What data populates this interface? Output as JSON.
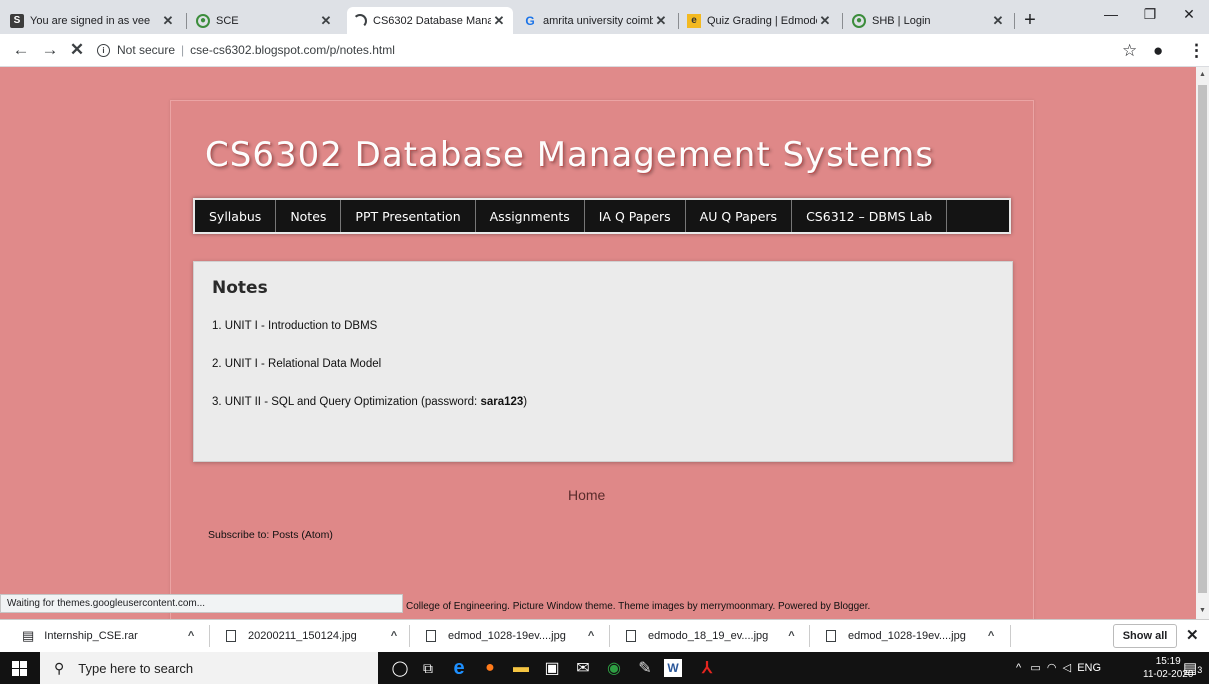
{
  "browser": {
    "tabs": [
      {
        "title": "You are signed in as vee",
        "icon": "blogger-s-icon"
      },
      {
        "title": "SCE",
        "icon": "globe-icon"
      },
      {
        "title": "CS6302 Database Mana",
        "icon": "loading-icon",
        "active": true
      },
      {
        "title": "amrita university coimb",
        "icon": "google-g-icon"
      },
      {
        "title": "Quiz Grading | Edmodo",
        "icon": "edmodo-icon"
      },
      {
        "title": "SHB | Login",
        "icon": "globe-icon"
      }
    ],
    "security_label": "Not secure",
    "url": "cse-cs6302.blogspot.com/p/notes.html"
  },
  "page": {
    "blog_title": "CS6302 Database Management Systems",
    "menu": [
      "Syllabus",
      "Notes",
      "PPT Presentation",
      "Assignments",
      "IA Q Papers",
      "AU Q Papers",
      "CS6312 – DBMS Lab"
    ],
    "post_title": "Notes",
    "notes": [
      {
        "text": "1. UNIT I - Introduction to DBMS"
      },
      {
        "text": "2. UNIT I - Relational Data Model"
      },
      {
        "text": "3. UNIT II - SQL and Query Optimization (password: ",
        "bold": "sara123",
        "suffix": ")"
      }
    ],
    "home_link": "Home",
    "subscribe": "Subscribe to: Posts (Atom)",
    "attribution": "College of Engineering. Picture Window theme. Theme images by merrymoonmary. Powered by Blogger."
  },
  "status_text": "Waiting for themes.googleusercontent.com...",
  "downloads": {
    "items": [
      "Internship_CSE.rar",
      "20200211_150124.jpg",
      "edmod_1028-19ev....jpg",
      "edmodo_18_19_ev....jpg",
      "edmod_1028-19ev....jpg"
    ],
    "show_all": "Show all"
  },
  "taskbar": {
    "search_placeholder": "Type here to search",
    "tray_lang": "ENG",
    "time": "15:19",
    "date": "11-02-2020",
    "notification_count": "3"
  },
  "colors": {
    "page_background": "#e08a8a",
    "menu_background": "#141414",
    "content_background": "#ebebeb"
  }
}
